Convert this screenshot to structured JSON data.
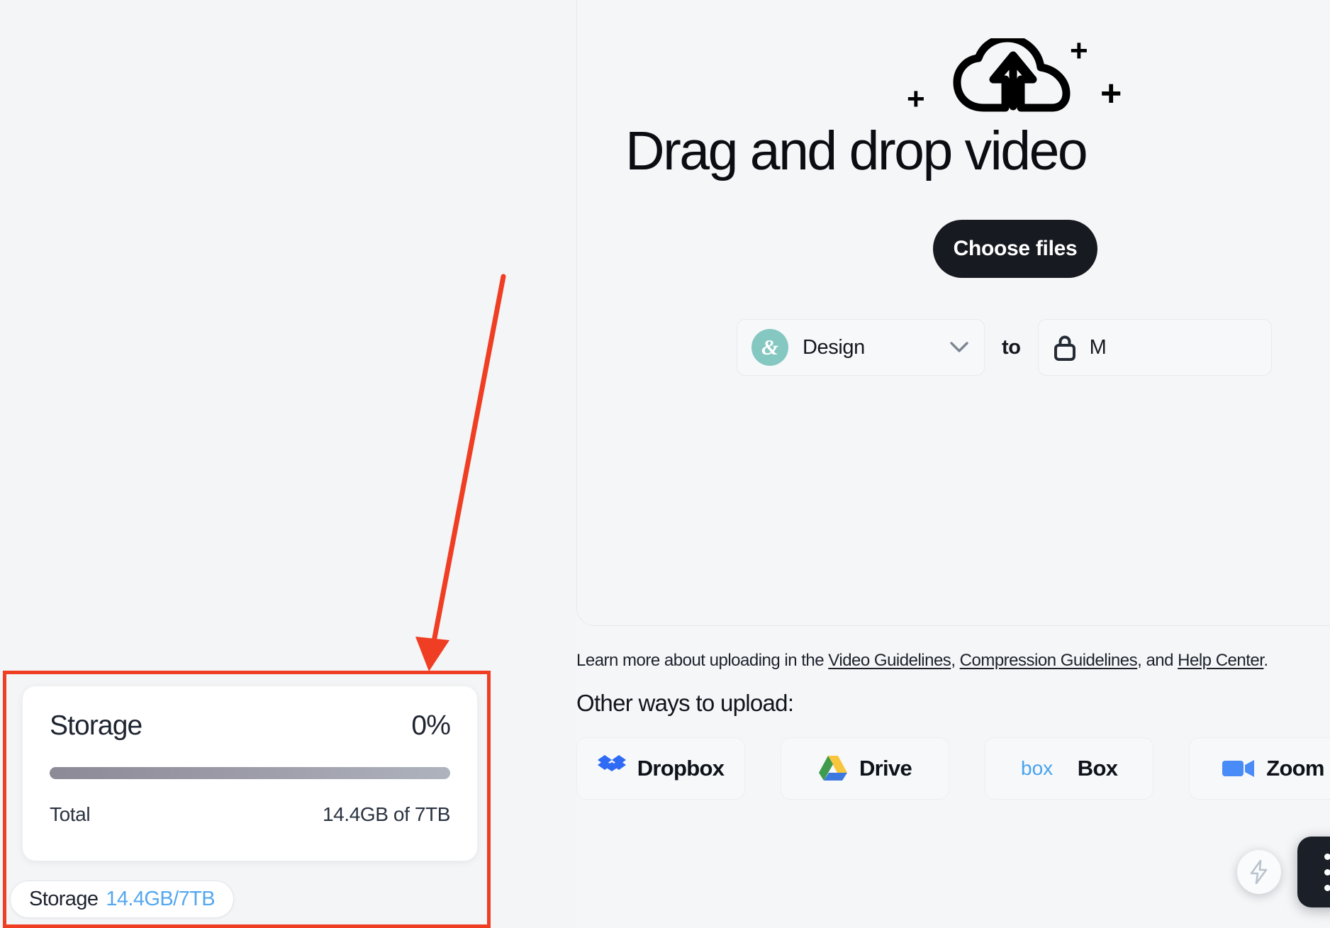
{
  "upload": {
    "cloud_icon": "cloud-upload-icon",
    "headline": "Drag and drop video",
    "choose_files_label": "Choose files",
    "team_avatar_glyph": "&",
    "team_name": "Design",
    "chevron_icon": "chevron-down-icon",
    "to_word": "to",
    "privacy_icon": "lock-icon",
    "privacy_label": "M",
    "learn_prefix": "Learn more about uploading in the ",
    "learn_links": [
      "Video Guidelines",
      "Compression Guidelines",
      "Help Center"
    ],
    "learn_sep1": ", ",
    "learn_sep2": ", and ",
    "learn_suffix": ".",
    "other_ways_title": "Other ways to upload:",
    "services": [
      {
        "name": "Dropbox",
        "icon": "dropbox-icon",
        "color": "#2f6bf5"
      },
      {
        "name": "Drive",
        "icon": "google-drive-icon",
        "color": "#3d8f40"
      },
      {
        "name": "Box",
        "icon": "box-icon",
        "color": "#48a3ee"
      },
      {
        "name": "Zoom",
        "icon": "zoom-icon",
        "color": "#4a8cf7"
      }
    ]
  },
  "storage_card": {
    "title": "Storage",
    "percent": "0%",
    "progress_value": 0,
    "total_label": "Total",
    "total_value": "14.4GB of 7TB",
    "bar_gradient_from": "#8d8a97",
    "bar_gradient_to": "#aeb3bd"
  },
  "storage_pill": {
    "label": "Storage",
    "value": "14.4GB/7TB",
    "value_color": "#54a7f0"
  },
  "floating": {
    "bolt_icon": "lightning-bolt-icon",
    "grid_icon": "apps-grid-icon"
  },
  "annotation": {
    "color": "#ef3e23",
    "shape": "rectangle-and-arrow"
  }
}
